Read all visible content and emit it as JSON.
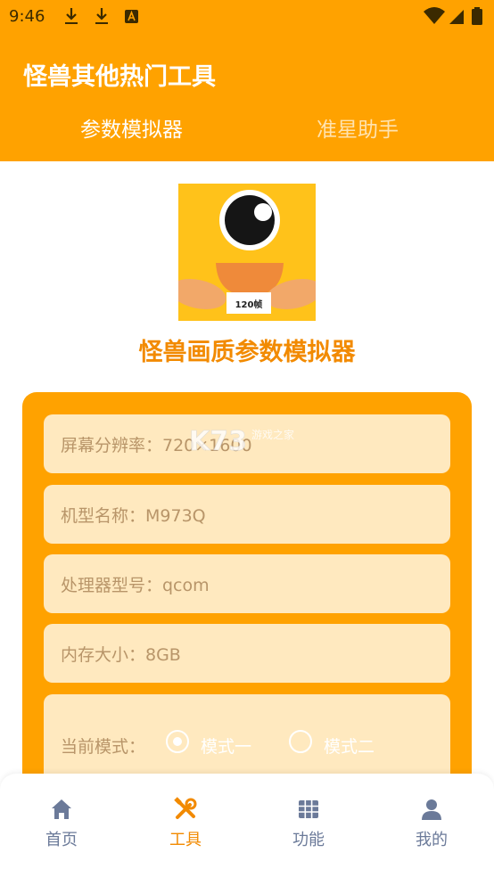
{
  "status": {
    "time": "9:46"
  },
  "header": {
    "title": "怪兽其他热门工具",
    "tabs": [
      {
        "label": "参数模拟器",
        "active": true
      },
      {
        "label": "准星助手",
        "active": false
      }
    ]
  },
  "tool": {
    "title": "怪兽画质参数模拟器",
    "logo_badge": "120帧"
  },
  "fields": {
    "resolution": "屏幕分辨率：720×1600",
    "model": "机型名称：M973Q",
    "processor": "处理器型号：qcom",
    "memory": "内存大小：8GB"
  },
  "mode": {
    "label": "当前模式：",
    "options": [
      {
        "label": "模式一",
        "selected": true
      },
      {
        "label": "模式二",
        "selected": false
      }
    ]
  },
  "watermark": {
    "text": "K73",
    "subtext": "游戏之家"
  },
  "nav": {
    "items": [
      {
        "label": "首页",
        "icon": "home-icon",
        "active": false
      },
      {
        "label": "工具",
        "icon": "tools-icon",
        "active": true
      },
      {
        "label": "功能",
        "icon": "grid-icon",
        "active": false
      },
      {
        "label": "我的",
        "icon": "person-icon",
        "active": false
      }
    ]
  },
  "colors": {
    "accent": "#FFA200",
    "title_orange": "#F28A00",
    "field_bg": "#FFE9BF",
    "nav_inactive": "#6B7A99"
  }
}
